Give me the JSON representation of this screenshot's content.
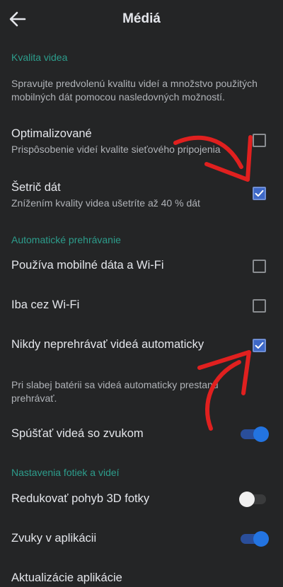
{
  "header": {
    "title": "Médiá",
    "back_icon": "arrow-left-icon"
  },
  "sections": {
    "video_quality": {
      "header": "Kvalita videa",
      "description": "Spravujte predvolenú kvalitu videí a množstvo použitých mobilných dát pomocou nasledovných možností."
    },
    "autoplay": {
      "header": "Automatické prehrávanie",
      "battery_note": "Pri slabej batérii sa videá automaticky prestanú prehrávať."
    },
    "photos_videos": {
      "header": "Nastavenia fotiek a videí"
    }
  },
  "options": {
    "optimized": {
      "title": "Optimalizované",
      "subtitle": "Prispôsobenie videí kvalite sieťového pripojenia",
      "checked": false
    },
    "data_saver": {
      "title": "Šetrič dát",
      "subtitle": "Znížením kvality videa ušetríte až 40 % dát",
      "checked": true
    },
    "mobile_wifi": {
      "title": "Používa mobilné dáta a Wi-Fi",
      "checked": false
    },
    "wifi_only": {
      "title": "Iba cez Wi-Fi",
      "checked": false
    },
    "never_autoplay": {
      "title": "Nikdy neprehrávať videá automaticky",
      "checked": true
    },
    "play_with_sound": {
      "title": "Spúšťať videá so zvukom",
      "on": true
    },
    "reduce_3d_motion": {
      "title": "Redukovať pohyb 3D fotky",
      "on": false
    },
    "app_sounds": {
      "title": "Zvuky v aplikácii",
      "on": true
    },
    "app_updates": {
      "title": "Aktualizácie aplikácie"
    }
  },
  "colors": {
    "background": "#242526",
    "section_accent": "#2d9d8c",
    "checkbox_checked": "#3d68c7",
    "toggle_on": "#2374e1",
    "annotation_arrow": "#e0201f"
  }
}
